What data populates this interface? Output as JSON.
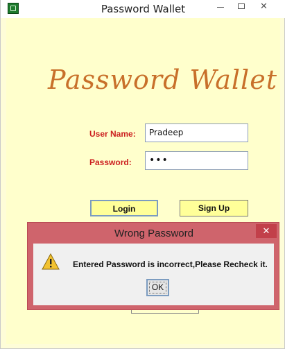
{
  "window": {
    "title": "Password Wallet",
    "min_icon": "minimize-icon",
    "max_icon": "maximize-icon",
    "close_icon": "close-icon",
    "close_glyph": "✕"
  },
  "app": {
    "brand_title": "Password Wallet",
    "brand_color": "#c8702a",
    "label_color": "#cc1f1f",
    "button_color": "#ffff99",
    "background_color": "#ffffcc"
  },
  "form": {
    "username_label": "User Name:",
    "username_value": "Pradeep",
    "password_label": "Password:",
    "password_value": "•••",
    "login_label": "Login",
    "signup_label": "Sign Up"
  },
  "dialog": {
    "title": "Wrong Password",
    "close_glyph": "✕",
    "icon": "warning-icon",
    "message": "Entered Password is incorrect,Please Recheck it.",
    "ok_label": "OK",
    "title_color": "#cf646c"
  }
}
